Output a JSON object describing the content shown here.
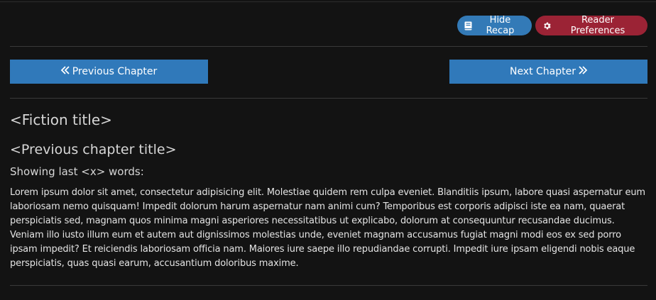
{
  "toolbar": {
    "hide_recap_label": "Hide Recap",
    "reader_preferences_label": "Reader Preferences"
  },
  "navigation": {
    "previous_label": "Previous Chapter",
    "next_label": "Next Chapter"
  },
  "recap": {
    "fiction_title": "<Fiction title>",
    "previous_chapter_title": "<Previous chapter title>",
    "words_note": "Showing last <x> words:",
    "text": "Lorem ipsum dolor sit amet, consectetur adipisicing elit. Molestiae quidem rem culpa eveniet. Blanditiis ipsum, labore quasi aspernatur eum laboriosam nemo quisquam! Impedit dolorum harum aspernatur nam animi cum? Temporibus est corporis adipisci iste ea nam, quaerat perspiciatis sed, magnam quos minima magni asperiores necessitatibus ut explicabo, dolorum at consequuntur recusandae ducimus. Veniam illo iusto illum eum et autem aut dignissimos molestias unde, eveniet magnam accusamus fugiat magni modi eos ex sed porro ipsam impedit? Et reiciendis laboriosam officia nam. Maiores iure saepe illo repudiandae corrupti. Impedit iure ipsam eligendi nobis eaque perspiciatis, quas quasi earum, accusantium doloribus maxime."
  },
  "colors": {
    "background": "#131313",
    "primary_button": "#337ab7",
    "danger_button": "#9b2335"
  },
  "icons": {
    "hide_recap": "book-icon",
    "reader_preferences": "gear-icon",
    "previous": "double-chevron-left-icon",
    "next": "double-chevron-right-icon"
  }
}
